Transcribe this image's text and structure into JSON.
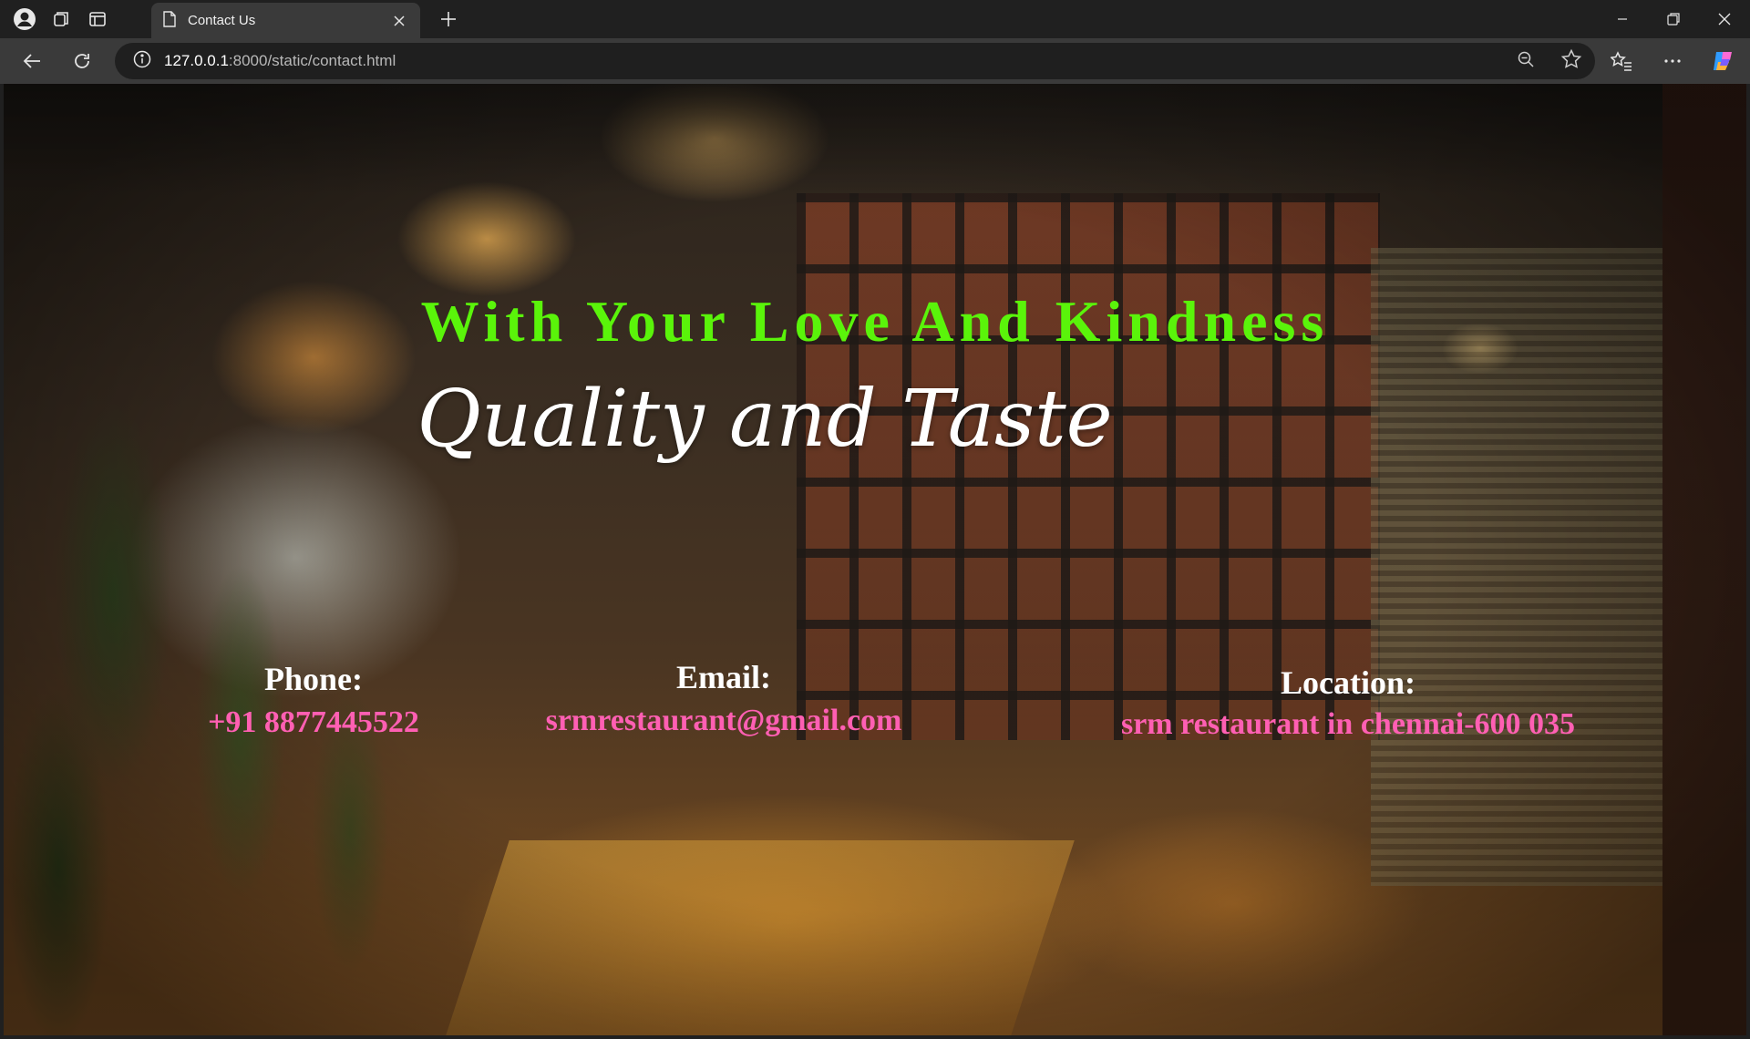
{
  "browser": {
    "tab_title": "Contact Us",
    "url_host": "127.0.0.1",
    "url_rest": ":8000/static/contact.html"
  },
  "page": {
    "headline": "With Your Love And Kindness",
    "subheadline": "Quality and Taste",
    "phone": {
      "label": "Phone:",
      "value": "+91 8877445522"
    },
    "email": {
      "label": "Email:",
      "value": "srmrestaurant@gmail.com"
    },
    "location": {
      "label": "Location:",
      "value": "srm restaurant in chennai-600 035"
    }
  },
  "colors": {
    "headline": "#5af40a",
    "subheadline": "#ffffff",
    "label": "#ffffff",
    "value": "#ff5fb3"
  },
  "icons": [
    "profile-icon",
    "workspaces-icon",
    "tab-actions-icon",
    "page-icon",
    "close-icon",
    "plus-icon",
    "minimize-icon",
    "restore-icon",
    "window-close-icon",
    "back-icon",
    "reload-icon",
    "info-icon",
    "zoom-out-icon",
    "star-icon",
    "favorites-icon",
    "more-icon",
    "copilot-icon"
  ]
}
